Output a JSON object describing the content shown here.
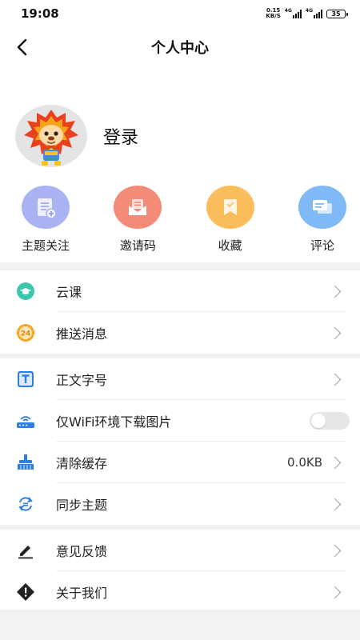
{
  "status_bar": {
    "time": "19:08",
    "speed_value": "0.15",
    "speed_unit": "KB/S",
    "network1": "4G",
    "network2": "4G",
    "battery": "35"
  },
  "header": {
    "title": "个人中心"
  },
  "profile": {
    "login_label": "登录"
  },
  "quick_actions": [
    {
      "label": "主题关注",
      "icon": "topic-follow-icon",
      "color": "#a9b3f4"
    },
    {
      "label": "邀请码",
      "icon": "invite-envelope-icon",
      "color": "#f48a78"
    },
    {
      "label": "收藏",
      "icon": "bookmark-icon",
      "color": "#fbbd5c"
    },
    {
      "label": "评论",
      "icon": "comment-icon",
      "color": "#7fb9f6"
    }
  ],
  "menu_group1": [
    {
      "label": "云课",
      "icon": "graduation-cap-icon"
    },
    {
      "label": "推送消息",
      "icon": "clock-24-icon"
    }
  ],
  "menu_group2": [
    {
      "label": "正文字号",
      "icon": "font-size-icon"
    },
    {
      "label": "仅WiFi环境下载图片",
      "icon": "wifi-router-icon",
      "toggle": false
    },
    {
      "label": "清除缓存",
      "icon": "broom-icon",
      "value": "0.0KB"
    },
    {
      "label": "同步主题",
      "icon": "sync-icon"
    }
  ],
  "menu_group3": [
    {
      "label": "意见反馈",
      "icon": "pencil-icon"
    },
    {
      "label": "关于我们",
      "icon": "info-diamond-icon"
    }
  ]
}
